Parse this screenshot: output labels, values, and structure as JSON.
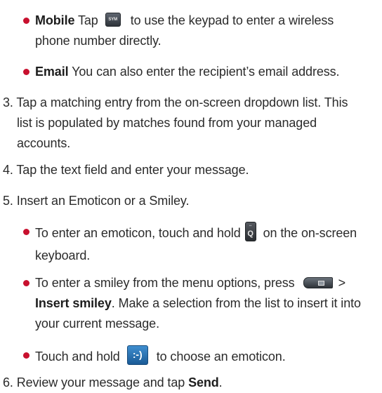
{
  "accent_color": "#c8102e",
  "mobile": {
    "title": "Mobile",
    "before": "Tap",
    "key_label": "SYM",
    "after": "to use the keypad to enter a wireless",
    "line2": "phone number directly."
  },
  "email": {
    "title": "Email",
    "text": "You can also enter the recipient’s email address."
  },
  "step3": {
    "line1": "3. Tap a matching entry from the on-screen dropdown list. This",
    "line2": "list is populated by matches found from your managed",
    "line3": "accounts."
  },
  "step4": {
    "text": "4. Tap the text field and enter your message."
  },
  "step5": {
    "text": "5. Insert an Emoticon or a Smiley."
  },
  "emoticon": {
    "before": "To enter an emoticon, touch and hold",
    "key_label": "Q",
    "after": "on the on-screen",
    "line2": "keyboard."
  },
  "smiley": {
    "before": "To enter a smiley from the menu options, press",
    "arrow": ">",
    "bold": "Insert smiley",
    "after": ". Make a selection from the list to insert it into",
    "line3": "your current message."
  },
  "hold": {
    "before": "Touch and hold",
    "key_label": ":-)",
    "after": "to choose an emoticon."
  },
  "step6": {
    "before": "6. Review your message and tap",
    "bold": "Send",
    "after": "."
  }
}
